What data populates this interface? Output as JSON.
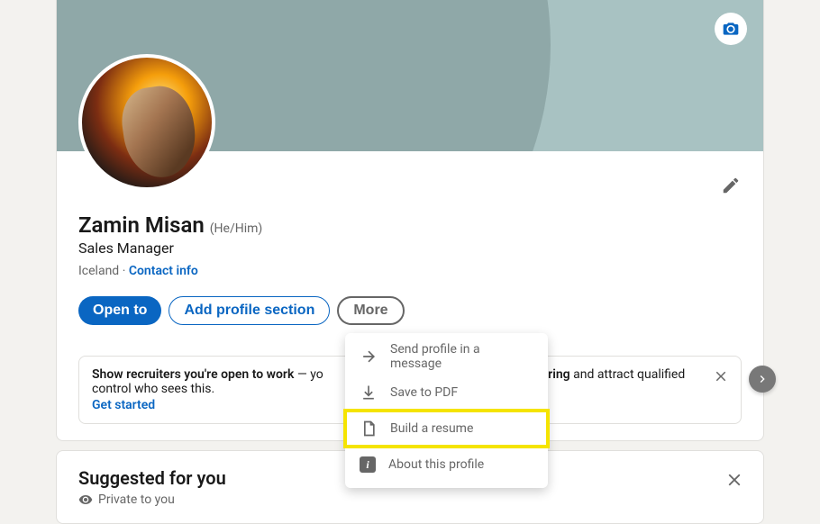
{
  "profile": {
    "name": "Zamin Misan",
    "pronouns": "(He/Him)",
    "headline": "Sales Manager",
    "location": "Iceland",
    "contact_label": "Contact info"
  },
  "actions": {
    "open_to": "Open to",
    "add_section": "Add profile section",
    "more": "More"
  },
  "open_card": {
    "bold": "Show recruiters you're open to work",
    "mid": " — yo",
    "tail_bold": "e hiring",
    "tail": " and attract qualified",
    "line2": "control who sees this.",
    "link": "Get started"
  },
  "dropdown": {
    "send": "Send profile in a message",
    "save_pdf": "Save to PDF",
    "build_resume": "Build a resume",
    "about": "About this profile"
  },
  "suggested": {
    "title": "Suggested for you",
    "private": "Private to you"
  }
}
